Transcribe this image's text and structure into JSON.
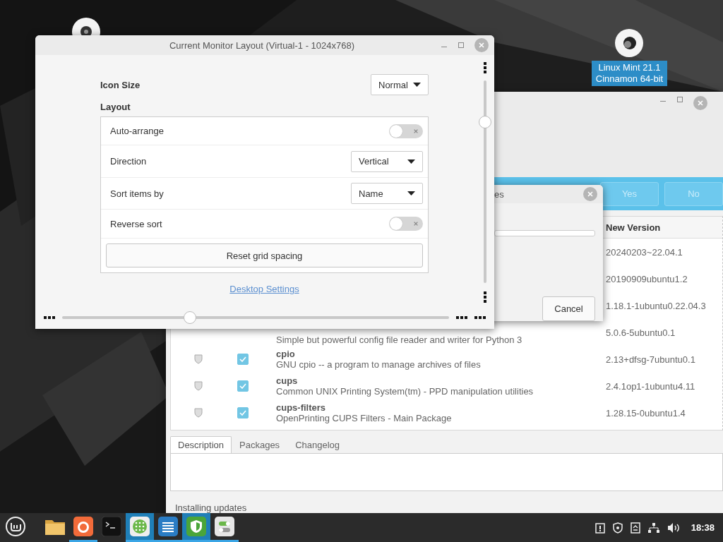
{
  "desktop_icon": {
    "label": [
      "Linux Mint 21.1",
      "Cinnamon 64-bit"
    ],
    "selected": true
  },
  "update_manager": {
    "banner": {
      "buttons": [
        {
          "label": "Yes"
        },
        {
          "label": "No"
        }
      ]
    },
    "table": {
      "columns": [
        "New Version"
      ],
      "rows": [
        {
          "version": "20240203~22.04.1"
        },
        {
          "version": "20190909ubuntu1.2"
        },
        {
          "version": "1.18.1-1ubuntu0.22.04.3"
        },
        {
          "description": "Simple but powerful config file reader and writer for Python 3",
          "version": "5.0.6-5ubuntu0.1"
        },
        {
          "name": "cpio",
          "description": "GNU cpio -- a program to manage archives of files",
          "checked": true,
          "version": "2.13+dfsg-7ubuntu0.1"
        },
        {
          "name": "cups",
          "description": "Common UNIX Printing System(tm) - PPD manipulation utilities",
          "checked": true,
          "version": "2.4.1op1-1ubuntu4.11"
        },
        {
          "name": "cups-filters",
          "description": "OpenPrinting CUPS Filters - Main Package",
          "checked": true,
          "version": "1.28.15-0ubuntu1.4"
        }
      ]
    },
    "tabs": [
      {
        "label": "Description",
        "selected": true
      },
      {
        "label": "Packages",
        "selected": false
      },
      {
        "label": "Changelog",
        "selected": false
      }
    ],
    "status": "Installing updates"
  },
  "progress_dialog": {
    "title": "es",
    "progress": {
      "level": 0
    },
    "button": "Cancel"
  },
  "monitor_window": {
    "title": "Current Monitor Layout (Virtual-1 - 1024x768)",
    "icon_size": {
      "label": "Icon Size",
      "value": "Normal"
    },
    "layout": {
      "heading": "Layout",
      "rows": [
        {
          "kind": "switch",
          "label": "Auto-arrange",
          "on": false
        },
        {
          "kind": "dropdown",
          "label": "Direction",
          "value": "Vertical"
        },
        {
          "kind": "dropdown",
          "label": "Sort items by",
          "value": "Name"
        },
        {
          "kind": "switch",
          "label": "Reverse sort",
          "on": false
        },
        {
          "kind": "button",
          "label": "Reset grid spacing"
        }
      ]
    },
    "link": "Desktop Settings",
    "horizontal_slider": {
      "level": 0.33
    }
  },
  "taskbar": {
    "apps": [
      {
        "kind": "folder",
        "running": false,
        "active": false
      },
      {
        "kind": "browser",
        "running": true,
        "active": false
      },
      {
        "kind": "terminal",
        "running": false,
        "active": false
      },
      {
        "kind": "grid",
        "running": true,
        "active": true
      },
      {
        "kind": "editor",
        "running": true,
        "active": false
      },
      {
        "kind": "shield",
        "running": true,
        "active": true
      },
      {
        "kind": "toggles",
        "running": true,
        "active": false
      }
    ],
    "clock": "18:38"
  }
}
